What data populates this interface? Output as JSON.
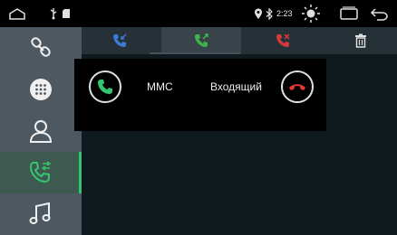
{
  "status_bar": {
    "time": "2:23",
    "icons": [
      "home-icon",
      "usb-icon",
      "sd-card-icon",
      "location-icon",
      "bluetooth-icon",
      "brightness-icon",
      "recent-apps-icon",
      "back-icon"
    ]
  },
  "sidebar": {
    "items": [
      {
        "icon": "link-icon",
        "active": false
      },
      {
        "icon": "dialpad-icon",
        "active": false
      },
      {
        "icon": "contacts-icon",
        "active": false
      },
      {
        "icon": "call-log-icon",
        "active": true
      },
      {
        "icon": "music-icon",
        "active": false
      }
    ]
  },
  "call_log_tabs": [
    {
      "icon": "incoming-call-icon",
      "color": "#3a7bd5",
      "selected": false
    },
    {
      "icon": "outgoing-call-icon",
      "color": "#3bb54a",
      "selected": true
    },
    {
      "icon": "missed-call-icon",
      "color": "#d43a3a",
      "selected": false
    }
  ],
  "toolbar": {
    "delete_icon": "trash-icon"
  },
  "incoming_call": {
    "caller": "MMC",
    "status": "Входящий",
    "accept_color": "#37c46e",
    "decline_color": "#e53935"
  }
}
